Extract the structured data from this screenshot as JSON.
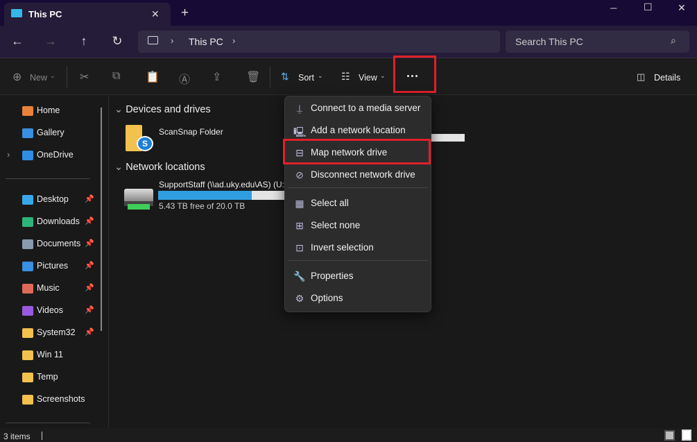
{
  "window": {
    "tab_title": "This PC",
    "new_tab": "+",
    "minimize": "─",
    "maximize": "☐",
    "close": "✕"
  },
  "nav": {
    "back": "←",
    "forward": "→",
    "up": "↑",
    "refresh": "↻",
    "breadcrumb": [
      "This PC"
    ],
    "search_placeholder": "Search This PC"
  },
  "toolbar": {
    "new_label": "New",
    "sort_label": "Sort",
    "view_label": "View",
    "more_label": "···",
    "details_label": "Details"
  },
  "sidebar": {
    "items": [
      {
        "label": "Home",
        "icon": "home-icon",
        "color": "#e8823a",
        "expand": false,
        "pin": false
      },
      {
        "label": "Gallery",
        "icon": "gallery-icon",
        "color": "#3a8fe0",
        "expand": false,
        "pin": false
      },
      {
        "label": "OneDrive",
        "icon": "onedrive-icon",
        "color": "#2f8de4",
        "expand": true,
        "pin": false
      },
      {
        "label": "Desktop",
        "icon": "desktop-icon",
        "color": "#3aa8e8",
        "pin": true
      },
      {
        "label": "Downloads",
        "icon": "downloads-icon",
        "color": "#2fb37a",
        "pin": true
      },
      {
        "label": "Documents",
        "icon": "documents-icon",
        "color": "#8a9bb0",
        "pin": true
      },
      {
        "label": "Pictures",
        "icon": "pictures-icon",
        "color": "#3a8fe0",
        "pin": true
      },
      {
        "label": "Music",
        "icon": "music-icon",
        "color": "#e06a5a",
        "pin": true
      },
      {
        "label": "Videos",
        "icon": "videos-icon",
        "color": "#9a5ae0",
        "pin": true
      },
      {
        "label": "System32",
        "icon": "folder-icon",
        "color": "#f2c14e",
        "pin": true
      },
      {
        "label": "Win 11",
        "icon": "folder-icon",
        "color": "#f2c14e",
        "pin": false
      },
      {
        "label": "Temp",
        "icon": "folder-icon",
        "color": "#f2c14e",
        "pin": false
      },
      {
        "label": "Screenshots",
        "icon": "folder-icon",
        "color": "#f2c14e",
        "pin": false
      }
    ]
  },
  "main": {
    "devices_header": "Devices and drives",
    "scansnap": "ScanSnap Folder",
    "network_header": "Network locations",
    "drive_name": "SupportStaff (\\\\ad.uky.edu\\AS) (U:",
    "drive_free": "5.43 TB free of 20.0 TB",
    "drive_used_fraction": 0.73
  },
  "menu": {
    "items": [
      {
        "label": "Connect to a media server",
        "icon": "media-server-icon",
        "glyph": "⍊"
      },
      {
        "label": "Add a network location",
        "icon": "network-location-icon",
        "glyph": "🖳"
      },
      {
        "label": "Map network drive",
        "icon": "map-drive-icon",
        "glyph": "⊟",
        "highlighted": true
      },
      {
        "label": "Disconnect network drive",
        "icon": "disconnect-drive-icon",
        "glyph": "⊘"
      },
      {
        "label": "Select all",
        "icon": "select-all-icon",
        "glyph": "▦",
        "sep_before": true
      },
      {
        "label": "Select none",
        "icon": "select-none-icon",
        "glyph": "⊞"
      },
      {
        "label": "Invert selection",
        "icon": "invert-selection-icon",
        "glyph": "⊡"
      },
      {
        "label": "Properties",
        "icon": "properties-icon",
        "glyph": "🔧",
        "sep_before": true
      },
      {
        "label": "Options",
        "icon": "options-icon",
        "glyph": "⚙"
      }
    ]
  },
  "status": {
    "items_count": "3 items"
  },
  "colors": {
    "highlight": "#e0202a",
    "accent": "#2f9ee0"
  }
}
